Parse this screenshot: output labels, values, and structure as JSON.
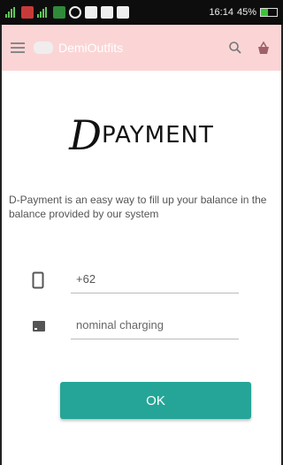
{
  "status_bar": {
    "time": "16:14",
    "battery_percent": "45%",
    "battery_level": 0.45,
    "icons": [
      "signal-icon",
      "app-icon",
      "signal-h-icon",
      "sim-icon",
      "whatsapp-icon",
      "mail-icon",
      "facebook-icon",
      "bbm-icon"
    ]
  },
  "app_bar": {
    "title": "DemiOutfits",
    "background": "#fbd5d6"
  },
  "brand": {
    "mark": "D",
    "word": "PAYMENT"
  },
  "description": "D-Payment is an easy way to fill up your balance in the balance provided by our system",
  "phone_field": {
    "value": "+62"
  },
  "nominal_field": {
    "placeholder": "nominal charging"
  },
  "ok_button": {
    "label": "OK",
    "color": "#25a597"
  }
}
